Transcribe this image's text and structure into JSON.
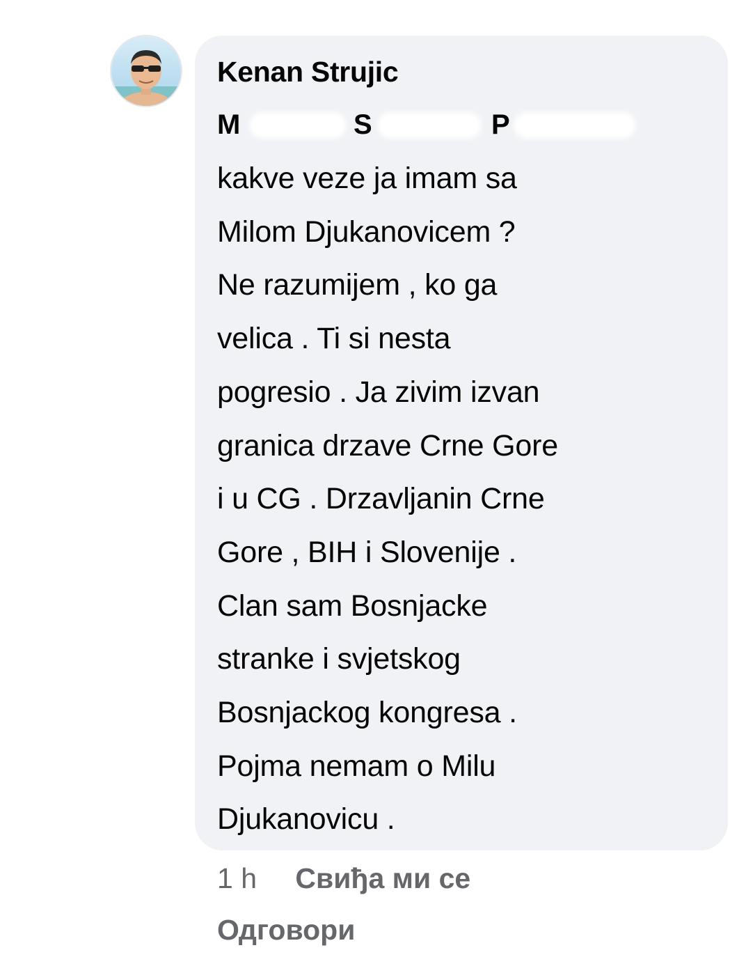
{
  "comment": {
    "author_name": "Kenan Strujic",
    "avatar_icon": "profile-photo",
    "tag": {
      "first_initial": "M",
      "second_initial": "S",
      "third_initial": "P"
    },
    "message": "kakve veze ja imam sa\nMilom Djukanovicem ?\nNe razumijem , ko ga\nvelica . Ti si nesta\npogresio . Ja zivim izvan\ngranica drzave Crne Gore\ni u CG . Drzavljanin Crne\nGore , BIH i Slovenije .\nClan sam Bosnjacke\nstranke i svjetskog\nBosnjackog kongresa .\nPojma nemam o Milu\nDjukanovicu ."
  },
  "actions": {
    "timestamp": "1 h",
    "like_label": "Свиђа ми се",
    "reply_label": "Одговори"
  },
  "colors": {
    "bubble_background": "#f0f2f5",
    "secondary_text": "#65676b",
    "primary_text": "#050505"
  }
}
